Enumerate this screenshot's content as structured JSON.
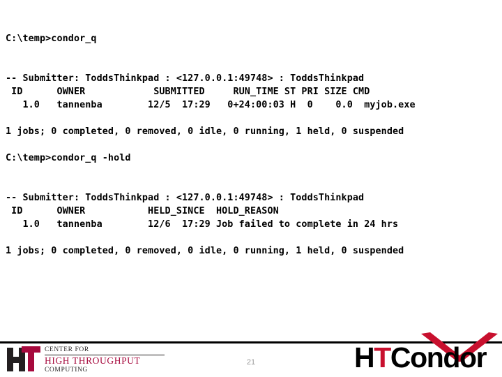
{
  "slide": {
    "page_number": "21",
    "background_color": "#ffffff",
    "text_color": "#000000"
  },
  "terminal": {
    "lines": [
      "C:\\temp>condor_q",
      "",
      "",
      "-- Submitter: ToddsThinkpad : <127.0.0.1:49748> : ToddsThinkpad",
      " ID      OWNER            SUBMITTED     RUN_TIME ST PRI SIZE CMD",
      "   1.0   tannenba        12/5  17:29   0+24:00:03 H  0    0.0  myjob.exe",
      "",
      "1 jobs; 0 completed, 0 removed, 0 idle, 0 running, 1 held, 0 suspended",
      "",
      "C:\\temp>condor_q -hold",
      "",
      "",
      "-- Submitter: ToddsThinkpad : <127.0.0.1:49748> : ToddsThinkpad",
      " ID      OWNER           HELD_SINCE  HOLD_REASON",
      "   1.0   tannenba        12/6  17:29 Job failed to complete in 24 hrs",
      "",
      "1 jobs; 0 completed, 0 removed, 0 idle, 0 running, 1 held, 0 suspended"
    ],
    "commands": {
      "first": "condor_q",
      "second": "condor_q -hold"
    },
    "prompt": "C:\\temp>",
    "submitter_line": "-- Submitter: ToddsThinkpad : <127.0.0.1:49748> : ToddsThinkpad",
    "queue_table": {
      "headers": [
        "ID",
        "OWNER",
        "SUBMITTED",
        "RUN_TIME",
        "ST",
        "PRI",
        "SIZE",
        "CMD"
      ],
      "rows": [
        [
          "1.0",
          "tannenba",
          "12/5  17:29",
          "0+24:00:03",
          "H",
          "0",
          "0.0",
          "myjob.exe"
        ]
      ]
    },
    "hold_table": {
      "headers": [
        "ID",
        "OWNER",
        "HELD_SINCE",
        "HOLD_REASON"
      ],
      "rows": [
        [
          "1.0",
          "tannenba",
          "12/6  17:29",
          "Job failed to complete in 24 hrs"
        ]
      ]
    },
    "summary": {
      "text": "1 jobs; 0 completed, 0 removed, 0 idle, 0 running, 1 held, 0 suspended",
      "jobs": 1,
      "completed": 0,
      "removed": 0,
      "idle": 0,
      "running": 0,
      "held": 1,
      "suspended": 0
    }
  },
  "footer": {
    "chtc_logo": {
      "mark_text": "HT",
      "line1": "CENTER FOR",
      "line2": "HIGH THROUGHPUT",
      "line3": "COMPUTING",
      "accent_color": "#a6093d",
      "dark_color": "#231f20"
    },
    "htcondor_logo": {
      "part_h": "H",
      "part_t": "T",
      "part_condor": "Condor",
      "full_text": "HTCondor",
      "accent_color": "#c8102e",
      "dark_color": "#000000",
      "chevron_name": "condor-chevron"
    }
  }
}
